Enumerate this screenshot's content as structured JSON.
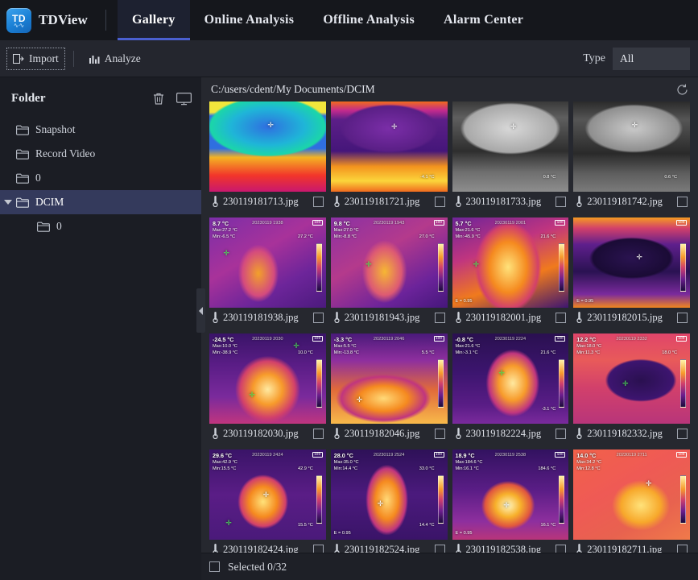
{
  "app": {
    "brand": "TDView",
    "logo_text": "TD"
  },
  "nav": {
    "tabs": [
      {
        "label": "Gallery",
        "active": true
      },
      {
        "label": "Online Analysis",
        "active": false
      },
      {
        "label": "Offline Analysis",
        "active": false
      },
      {
        "label": "Alarm Center",
        "active": false
      }
    ]
  },
  "toolbar": {
    "import_label": "Import",
    "analyze_label": "Analyze",
    "type_label": "Type",
    "type_value": "All"
  },
  "sidebar": {
    "title": "Folder",
    "delete_icon": "trash-icon",
    "monitor_icon": "monitor-icon",
    "items": [
      {
        "label": "Snapshot",
        "level": 1,
        "selected": false,
        "expandable": false
      },
      {
        "label": "Record Video",
        "level": 1,
        "selected": false,
        "expandable": false
      },
      {
        "label": "0",
        "level": 1,
        "selected": false,
        "expandable": false
      },
      {
        "label": "DCIM",
        "level": 1,
        "selected": true,
        "expandable": true
      },
      {
        "label": "0",
        "level": 2,
        "selected": false,
        "expandable": false
      }
    ]
  },
  "main": {
    "path": "C:/users/cdent/My Documents/DCIM",
    "refresh_icon": "refresh-icon"
  },
  "status": {
    "selected_label": "Selected 0/32",
    "checked": false
  },
  "gallery": {
    "images": [
      {
        "name": "230119181713.jpg",
        "checked": false,
        "temp": "",
        "max": "",
        "min": "",
        "date": "",
        "battery": "",
        "emissivity": "",
        "scale_top": "",
        "scale_bottom": "",
        "palette": "rainbow-window"
      },
      {
        "name": "230119181721.jpg",
        "checked": false,
        "temp": "",
        "max": "",
        "min": "",
        "date": "",
        "battery": "",
        "emissivity": "",
        "scale_top": "",
        "scale_bottom": "-4.1 °C",
        "palette": "ironbow-window"
      },
      {
        "name": "230119181733.jpg",
        "checked": false,
        "temp": "",
        "max": "",
        "min": "",
        "date": "",
        "battery": "",
        "emissivity": "",
        "scale_top": "",
        "scale_bottom": "0.8 °C",
        "palette": "gray-window"
      },
      {
        "name": "230119181742.jpg",
        "checked": false,
        "temp": "",
        "max": "",
        "min": "",
        "date": "",
        "battery": "",
        "emissivity": "",
        "scale_top": "",
        "scale_bottom": "0.6 °C",
        "palette": "gray-window2"
      },
      {
        "name": "230119181938.jpg",
        "checked": false,
        "temp": "8.7 °C",
        "max": "Max:27.2 °C",
        "min": "Min:-6.5 °C",
        "date": "20230119 1938",
        "battery": "100",
        "emissivity": "",
        "scale_top": "27.2 °C",
        "scale_bottom": "",
        "palette": "ironbow-person"
      },
      {
        "name": "230119181943.jpg",
        "checked": false,
        "temp": "9.8 °C",
        "max": "Max:27.0 °C",
        "min": "Min:-8.8 °C",
        "date": "20230119 1943",
        "battery": "100",
        "emissivity": "",
        "scale_top": "27.0 °C",
        "scale_bottom": "",
        "palette": "ironbow-person2"
      },
      {
        "name": "230119182001.jpg",
        "checked": false,
        "temp": "5.7 °C",
        "max": "Max:21.6 °C",
        "min": "Min:-45.9 °C",
        "date": "20230119 2001",
        "battery": "100",
        "emissivity": "E = 0.95",
        "scale_top": "21.6 °C",
        "scale_bottom": "",
        "palette": "ironbow-hot"
      },
      {
        "name": "230119182015.jpg",
        "checked": false,
        "temp": "",
        "max": "",
        "min": "",
        "date": "",
        "battery": "100",
        "emissivity": "E = 0.95",
        "scale_top": "",
        "scale_bottom": "",
        "palette": "ironbow-dark"
      },
      {
        "name": "230119182030.jpg",
        "checked": false,
        "temp": "-24.5 °C",
        "max": "Max:10.0 °C",
        "min": "Min:-38.9 °C",
        "date": "20230119 2030",
        "battery": "100",
        "emissivity": "",
        "scale_top": "10.0 °C",
        "scale_bottom": "",
        "palette": "tree"
      },
      {
        "name": "230119182046.jpg",
        "checked": false,
        "temp": "-3.3 °C",
        "max": "Max:5.5 °C",
        "min": "Min:-13.8 °C",
        "date": "20230119 2046",
        "battery": "100",
        "emissivity": "",
        "scale_top": "5.5 °C",
        "scale_bottom": "",
        "palette": "street"
      },
      {
        "name": "230119182224.jpg",
        "checked": false,
        "temp": "-0.8 °C",
        "max": "Max:21.6 °C",
        "min": "Min:-3.1 °C",
        "date": "20230119 2224",
        "battery": "100",
        "emissivity": "",
        "scale_top": "21.6 °C",
        "scale_bottom": "-3.1 °C",
        "palette": "hand"
      },
      {
        "name": "230119182332.jpg",
        "checked": false,
        "temp": "12.2 °C",
        "max": "Max:18.0 °C",
        "min": "Min:11.3 °C",
        "date": "20230119 2332",
        "battery": "100",
        "emissivity": "",
        "scale_top": "18.0 °C",
        "scale_bottom": "",
        "palette": "window-red"
      },
      {
        "name": "230119182424.jpg",
        "checked": false,
        "temp": "29.6 °C",
        "max": "Max:42.9 °C",
        "min": "Min:15.5 °C",
        "date": "20230119 2424",
        "battery": "100",
        "emissivity": "",
        "scale_top": "42.9 °C",
        "scale_bottom": "15.5 °C",
        "palette": "object-hot"
      },
      {
        "name": "230119182524.jpg",
        "checked": false,
        "temp": "28.0 °C",
        "max": "Max:35.0 °C",
        "min": "Min:14.4 °C",
        "date": "20230119 2524",
        "battery": "100",
        "emissivity": "E = 0.95",
        "scale_top": "33.0 °C",
        "scale_bottom": "14.4 °C",
        "palette": "person-hot"
      },
      {
        "name": "230119182538.jpg",
        "checked": false,
        "temp": "18.9 °C",
        "max": "Max:184.6 °C",
        "min": "Min:16.1 °C",
        "date": "20230119 2538",
        "battery": "100",
        "emissivity": "E = 0.95",
        "scale_top": "184.6 °C",
        "scale_bottom": "16.1 °C",
        "palette": "flame"
      },
      {
        "name": "230119182711.jpg",
        "checked": false,
        "temp": "14.0 °C",
        "max": "Max:34.2 °C",
        "min": "Min:12.8 °C",
        "date": "20230119 2711",
        "battery": "100",
        "emissivity": "",
        "scale_top": "",
        "scale_bottom": "",
        "palette": "warm-room"
      }
    ]
  }
}
